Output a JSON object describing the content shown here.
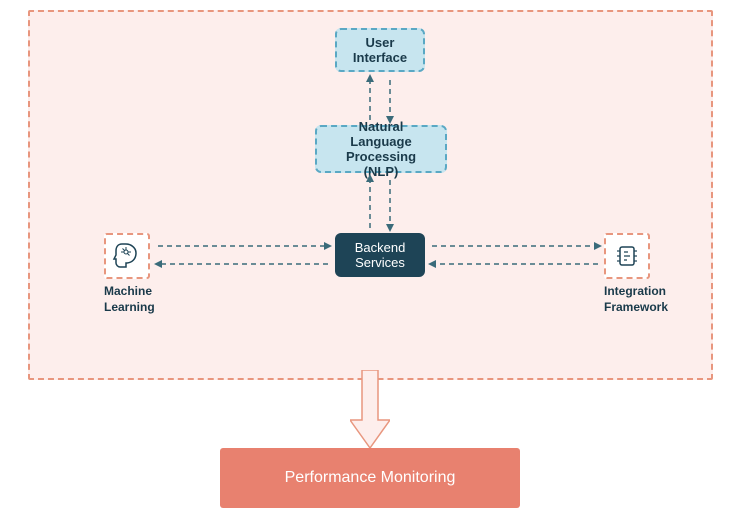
{
  "nodes": {
    "user_interface": "User\nInterface",
    "nlp": "Natural Language\nProcessing (NLP)",
    "backend": "Backend\nServices",
    "ml": "Machine\nLearning",
    "integration": "Integration\nFramework",
    "performance": "Performance Monitoring"
  },
  "layout": {
    "type": "architecture-diagram",
    "description": "System architecture with bidirectional flows between Backend Services and UI/NLP/ML/Integration components, all feeding into Performance Monitoring"
  }
}
